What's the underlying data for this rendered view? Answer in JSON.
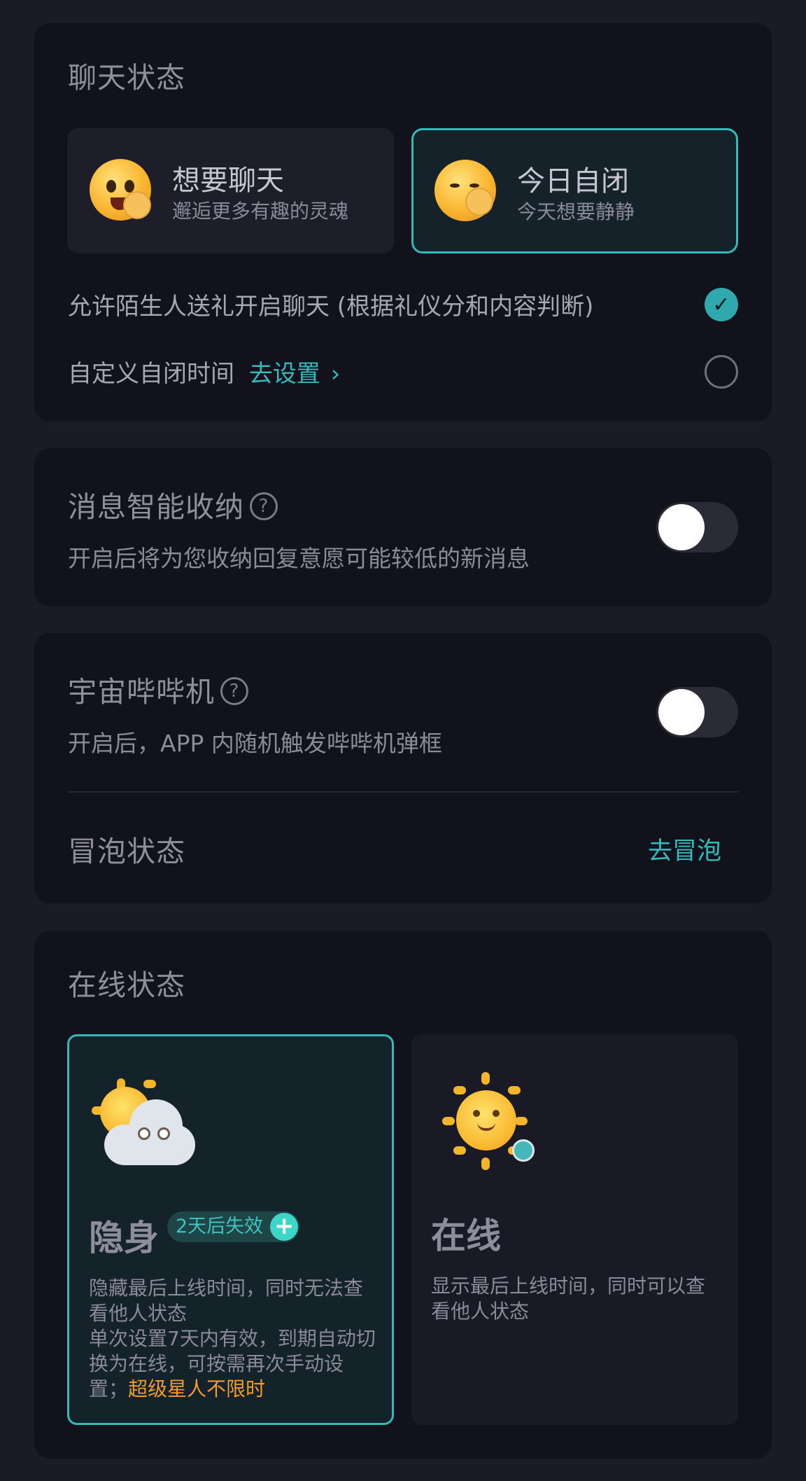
{
  "chat_status": {
    "title": "聊天状态",
    "options": [
      {
        "name": "想要聊天",
        "desc": "邂逅更多有趣的灵魂",
        "emoji": "waving-grin-emoji-icon",
        "selected": false
      },
      {
        "name": "今日自闭",
        "desc": "今天想要静静",
        "emoji": "waving-shy-emoji-icon",
        "selected": true
      }
    ],
    "allow_gift_label": "允许陌生人送礼开启聊天 (根据礼仪分和内容判断)",
    "allow_gift_checked": true,
    "custom_time_label": "自定义自闭时间",
    "custom_time_link": "去设置",
    "custom_time_checked": false
  },
  "message_fold": {
    "title": "消息智能收纳",
    "desc": "开启后将为您收纳回复意愿可能较低的新消息",
    "enabled": false
  },
  "universe_beep": {
    "title": "宇宙哔哔机",
    "desc": "开启后，APP 内随机触发哔哔机弹框",
    "enabled": false
  },
  "bubble_status": {
    "title": "冒泡状态",
    "action": "去冒泡"
  },
  "online_status": {
    "title": "在线状态",
    "invisible": {
      "name": "隐身",
      "badge": "2天后失效",
      "desc1": "隐藏最后上线时间，同时无法查看他人状态",
      "desc2": "单次设置7天内有效，到期自动切换为在线，可按需再次手动设置；",
      "highlight": "超级星人不限时",
      "selected": true
    },
    "online": {
      "name": "在线",
      "desc": "显示最后上线时间，同时可以查看他人状态",
      "selected": false
    }
  },
  "colors": {
    "background": "#1b1b26",
    "card": "#12121c",
    "accent": "#34b8b8",
    "highlight_orange": "#f59a2c"
  }
}
